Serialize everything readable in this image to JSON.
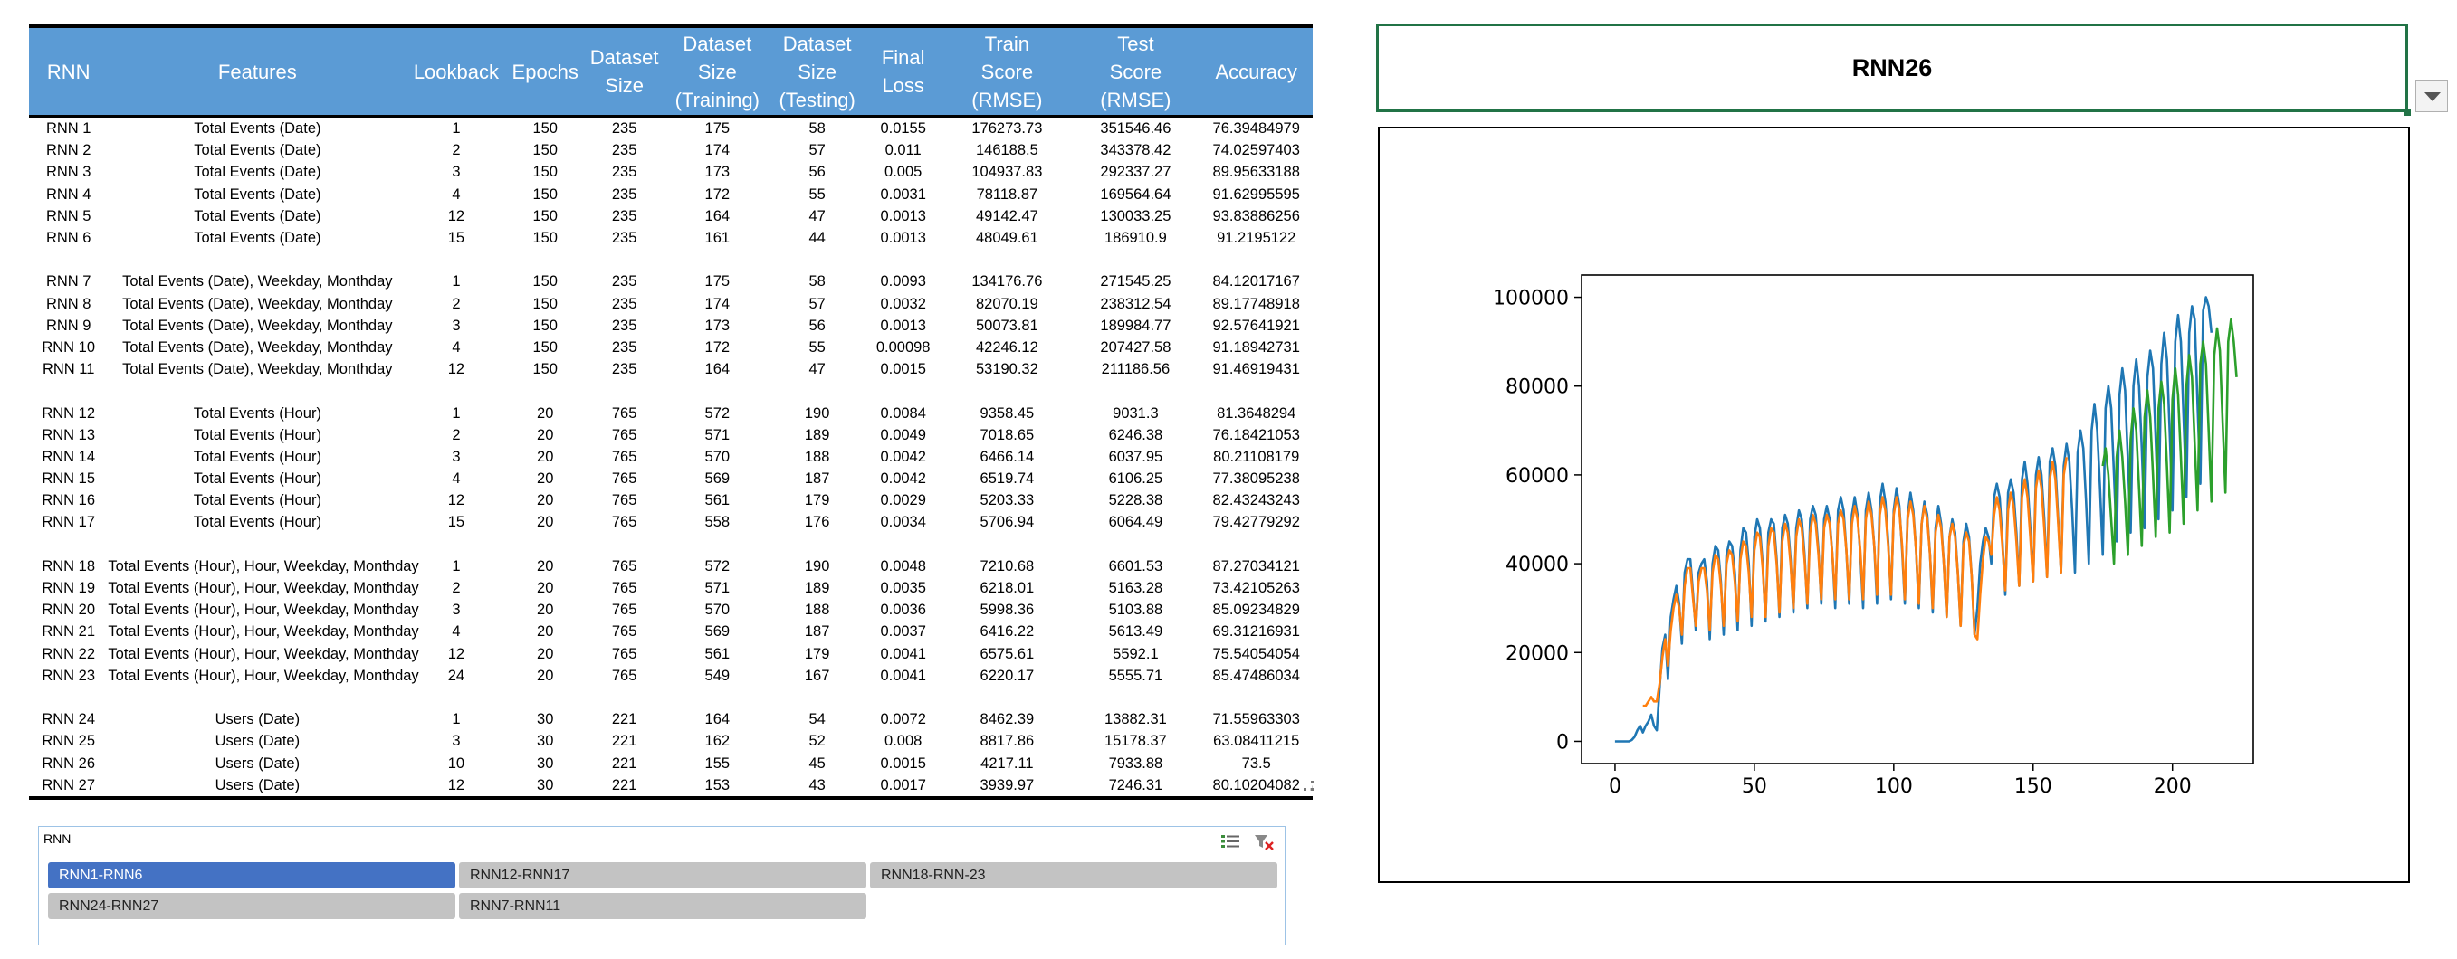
{
  "table": {
    "headers": [
      [
        "RNN"
      ],
      [
        "Features"
      ],
      [
        "Lookback"
      ],
      [
        "Epochs"
      ],
      [
        "Dataset",
        "Size"
      ],
      [
        "Dataset",
        "Size",
        "(Training)"
      ],
      [
        "Dataset",
        "Size",
        "(Testing)"
      ],
      [
        "Final",
        "Loss"
      ],
      [
        "Train",
        "Score",
        "(RMSE)"
      ],
      [
        "Test",
        "Score",
        "(RMSE)"
      ],
      [
        "Accuracy"
      ]
    ],
    "rows": [
      [
        "RNN 1",
        "Total Events (Date)",
        "1",
        "150",
        "235",
        "175",
        "58",
        "0.0155",
        "176273.73",
        "351546.46",
        "76.39484979"
      ],
      [
        "RNN 2",
        "Total Events (Date)",
        "2",
        "150",
        "235",
        "174",
        "57",
        "0.011",
        "146188.5",
        "343378.42",
        "74.02597403"
      ],
      [
        "RNN 3",
        "Total Events (Date)",
        "3",
        "150",
        "235",
        "173",
        "56",
        "0.005",
        "104937.83",
        "292337.27",
        "89.95633188"
      ],
      [
        "RNN 4",
        "Total Events (Date)",
        "4",
        "150",
        "235",
        "172",
        "55",
        "0.0031",
        "78118.87",
        "169564.64",
        "91.62995595"
      ],
      [
        "RNN 5",
        "Total Events (Date)",
        "12",
        "150",
        "235",
        "164",
        "47",
        "0.0013",
        "49142.47",
        "130033.25",
        "93.83886256"
      ],
      [
        "RNN 6",
        "Total Events (Date)",
        "15",
        "150",
        "235",
        "161",
        "44",
        "0.0013",
        "48049.61",
        "186910.9",
        "91.2195122"
      ],
      [],
      [
        "RNN 7",
        "Total Events (Date), Weekday, Monthday",
        "1",
        "150",
        "235",
        "175",
        "58",
        "0.0093",
        "134176.76",
        "271545.25",
        "84.12017167"
      ],
      [
        "RNN 8",
        "Total Events (Date), Weekday, Monthday",
        "2",
        "150",
        "235",
        "174",
        "57",
        "0.0032",
        "82070.19",
        "238312.54",
        "89.17748918"
      ],
      [
        "RNN 9",
        "Total Events (Date), Weekday, Monthday",
        "3",
        "150",
        "235",
        "173",
        "56",
        "0.0013",
        "50073.81",
        "189984.77",
        "92.57641921"
      ],
      [
        "RNN 10",
        "Total Events (Date), Weekday, Monthday",
        "4",
        "150",
        "235",
        "172",
        "55",
        "0.00098",
        "42246.12",
        "207427.58",
        "91.18942731"
      ],
      [
        "RNN 11",
        "Total Events (Date), Weekday, Monthday",
        "12",
        "150",
        "235",
        "164",
        "47",
        "0.0015",
        "53190.32",
        "211186.56",
        "91.46919431"
      ],
      [],
      [
        "RNN 12",
        "Total Events (Hour)",
        "1",
        "20",
        "765",
        "572",
        "190",
        "0.0084",
        "9358.45",
        "9031.3",
        "81.3648294"
      ],
      [
        "RNN 13",
        "Total Events (Hour)",
        "2",
        "20",
        "765",
        "571",
        "189",
        "0.0049",
        "7018.65",
        "6246.38",
        "76.18421053"
      ],
      [
        "RNN 14",
        "Total Events (Hour)",
        "3",
        "20",
        "765",
        "570",
        "188",
        "0.0042",
        "6466.14",
        "6037.95",
        "80.21108179"
      ],
      [
        "RNN 15",
        "Total Events (Hour)",
        "4",
        "20",
        "765",
        "569",
        "187",
        "0.0042",
        "6519.74",
        "6106.25",
        "77.38095238"
      ],
      [
        "RNN 16",
        "Total Events (Hour)",
        "12",
        "20",
        "765",
        "561",
        "179",
        "0.0029",
        "5203.33",
        "5228.38",
        "82.43243243"
      ],
      [
        "RNN 17",
        "Total Events (Hour)",
        "15",
        "20",
        "765",
        "558",
        "176",
        "0.0034",
        "5706.94",
        "6064.49",
        "79.42779292"
      ],
      [],
      [
        "RNN 18",
        "Total Events (Hour), Hour, Weekday, Monthday",
        "1",
        "20",
        "765",
        "572",
        "190",
        "0.0048",
        "7210.68",
        "6601.53",
        "87.27034121"
      ],
      [
        "RNN 19",
        "Total Events (Hour), Hour, Weekday, Monthday",
        "2",
        "20",
        "765",
        "571",
        "189",
        "0.0035",
        "6218.01",
        "5163.28",
        "73.42105263"
      ],
      [
        "RNN 20",
        "Total Events (Hour), Hour, Weekday, Monthday",
        "3",
        "20",
        "765",
        "570",
        "188",
        "0.0036",
        "5998.36",
        "5103.88",
        "85.09234829"
      ],
      [
        "RNN 21",
        "Total Events (Hour), Hour, Weekday, Monthday",
        "4",
        "20",
        "765",
        "569",
        "187",
        "0.0037",
        "6416.22",
        "5613.49",
        "69.31216931"
      ],
      [
        "RNN 22",
        "Total Events (Hour), Hour, Weekday, Monthday",
        "12",
        "20",
        "765",
        "561",
        "179",
        "0.0041",
        "6575.61",
        "5592.1",
        "75.54054054"
      ],
      [
        "RNN 23",
        "Total Events (Hour), Hour, Weekday, Monthday",
        "24",
        "20",
        "765",
        "549",
        "167",
        "0.0041",
        "6220.17",
        "5555.71",
        "85.47486034"
      ],
      [],
      [
        "RNN 24",
        "Users (Date)",
        "1",
        "30",
        "221",
        "164",
        "54",
        "0.0072",
        "8462.39",
        "13882.31",
        "71.55963303"
      ],
      [
        "RNN 25",
        "Users (Date)",
        "3",
        "30",
        "221",
        "162",
        "52",
        "0.008",
        "8817.86",
        "15178.37",
        "63.08411215"
      ],
      [
        "RNN 26",
        "Users (Date)",
        "10",
        "30",
        "221",
        "155",
        "45",
        "0.0015",
        "4217.11",
        "7933.88",
        "73.5"
      ],
      [
        "RNN 27",
        "Users (Date)",
        "12",
        "30",
        "221",
        "153",
        "43",
        "0.0017",
        "3939.97",
        "7246.31",
        "80.10204082"
      ]
    ]
  },
  "slicer": {
    "title": "RNN",
    "items": [
      {
        "label": "RNN1-RNN6",
        "selected": true
      },
      {
        "label": "RNN12-RNN17",
        "selected": false
      },
      {
        "label": "RNN18-RNN-23",
        "selected": false
      },
      {
        "label": "RNN24-RNN27",
        "selected": false
      },
      {
        "label": "RNN7-RNN11",
        "selected": false
      }
    ],
    "multiselect_icon": "multi-select-icon",
    "clear_filter_icon": "clear-filter-icon"
  },
  "selected_cell": {
    "value": "RNN26",
    "dropdown_icon": "dropdown-arrow-icon"
  },
  "chart_data": {
    "type": "line",
    "xlim": [
      -12,
      229
    ],
    "ylim": [
      -5000,
      105000
    ],
    "xticks": [
      0,
      50,
      100,
      150,
      200
    ],
    "yticks": [
      0,
      20000,
      40000,
      60000,
      80000,
      100000
    ],
    "grid": false,
    "colors": {
      "actual": "#1f77b4",
      "train_predict": "#ff7f0e",
      "test_predict": "#2ca02c"
    },
    "series": [
      {
        "key": "actual",
        "x_start": 0,
        "values": [
          0,
          0,
          0,
          0,
          0,
          0,
          300,
          1000,
          2500,
          3500,
          2000,
          3500,
          4500,
          6000,
          3500,
          2500,
          12000,
          21000,
          24000,
          14000,
          28000,
          32000,
          35000,
          31000,
          22000,
          38000,
          41000,
          41000,
          33000,
          25000,
          38000,
          40000,
          41000,
          36000,
          23000,
          40000,
          44000,
          43000,
          36000,
          24000,
          42000,
          45000,
          44000,
          38000,
          25000,
          43000,
          48000,
          47000,
          40000,
          26000,
          46000,
          50000,
          48000,
          40000,
          27000,
          47000,
          50000,
          49000,
          41000,
          28000,
          48000,
          51000,
          49000,
          41000,
          29000,
          48000,
          52000,
          50000,
          42000,
          30000,
          50000,
          53000,
          51000,
          43000,
          31000,
          50000,
          53000,
          50000,
          42000,
          30000,
          52000,
          55000,
          52000,
          43000,
          31000,
          51000,
          55000,
          51000,
          42000,
          30000,
          52000,
          56000,
          52000,
          44000,
          31000,
          54000,
          58000,
          54000,
          45000,
          32000,
          52000,
          57000,
          53000,
          43000,
          31000,
          51000,
          56000,
          52000,
          43000,
          30000,
          49000,
          54000,
          51000,
          42000,
          29000,
          48000,
          53000,
          49000,
          40000,
          28000,
          46000,
          50000,
          47000,
          38000,
          26000,
          45000,
          49000,
          46000,
          37000,
          24000,
          30000,
          40000,
          45000,
          48000,
          46000,
          40000,
          55000,
          58000,
          55000,
          45000,
          33000,
          56000,
          59000,
          56000,
          47000,
          35000,
          59000,
          63000,
          58000,
          48000,
          36000,
          60000,
          64000,
          60000,
          50000,
          37000,
          63000,
          66000,
          62000,
          50000,
          38000,
          62000,
          67000,
          63000,
          52000,
          38000,
          65000,
          70000,
          66000,
          54000,
          40000,
          70000,
          76000,
          70000,
          57000,
          42000,
          75000,
          80000,
          75000,
          60000,
          45000,
          78000,
          84000,
          79000,
          63000,
          47000,
          80000,
          86000,
          80000,
          66000,
          48000,
          82000,
          88000,
          84000,
          68000,
          50000,
          85000,
          92000,
          86000,
          70000,
          52000,
          90000,
          96000,
          90000,
          73000,
          55000,
          92000,
          98000,
          95000,
          76000,
          58000,
          97000,
          100000,
          98000,
          92000
        ]
      },
      {
        "key": "train_predict",
        "x_start": 10,
        "values": [
          8000,
          8000,
          9000,
          10000,
          9000,
          9000,
          13000,
          19000,
          23000,
          17000,
          25000,
          30000,
          33000,
          30000,
          24000,
          35000,
          39000,
          39000,
          32000,
          26000,
          36000,
          39000,
          39000,
          34000,
          25000,
          38000,
          42000,
          41000,
          35000,
          26000,
          40000,
          43000,
          42000,
          36000,
          27000,
          41000,
          45000,
          44000,
          38000,
          28000,
          43000,
          47000,
          46000,
          39000,
          28000,
          44000,
          48000,
          47000,
          40000,
          29000,
          45000,
          49000,
          47000,
          40000,
          30000,
          46000,
          50000,
          48000,
          41000,
          31000,
          47000,
          51000,
          49000,
          42000,
          32000,
          48000,
          51000,
          49000,
          42000,
          32000,
          49000,
          52000,
          50000,
          43000,
          32000,
          49000,
          53000,
          50000,
          43000,
          32000,
          50000,
          54000,
          51000,
          44000,
          33000,
          51000,
          55000,
          52000,
          44000,
          33000,
          51000,
          55000,
          52000,
          44000,
          32000,
          50000,
          54000,
          51000,
          43000,
          31000,
          49000,
          53000,
          50000,
          42000,
          30000,
          47000,
          51000,
          48000,
          40000,
          28000,
          46000,
          49000,
          46000,
          38000,
          26000,
          44000,
          47000,
          45000,
          37000,
          24000,
          23000,
          33000,
          41000,
          46000,
          45000,
          42000,
          51000,
          55000,
          52000,
          44000,
          34000,
          52000,
          56000,
          53000,
          45000,
          35000,
          55000,
          59000,
          55000,
          46000,
          36000,
          57000,
          61000,
          57000,
          48000,
          37000,
          59000,
          63000,
          59000,
          49000,
          38000,
          60000,
          64000
        ]
      },
      {
        "key": "test_predict",
        "x_start": 175,
        "values": [
          62000,
          66000,
          60000,
          50000,
          40000,
          64000,
          70000,
          64000,
          54000,
          42000,
          68000,
          75000,
          70000,
          57000,
          44000,
          73000,
          79000,
          73000,
          60000,
          46000,
          75000,
          81000,
          76000,
          62000,
          47000,
          77000,
          84000,
          78000,
          64000,
          49000,
          80000,
          87000,
          82000,
          67000,
          52000,
          85000,
          90000,
          85000,
          70000,
          54000,
          87000,
          93000,
          88000,
          72000,
          56000,
          90000,
          95000,
          90000,
          82000
        ]
      }
    ]
  }
}
